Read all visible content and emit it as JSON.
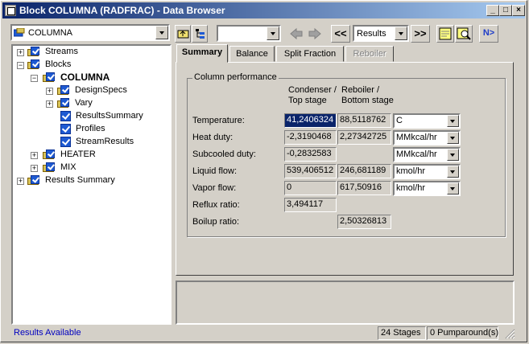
{
  "window": {
    "title": "Block COLUMNA (RADFRAC) - Data Browser",
    "buttons": {
      "minimize": "_",
      "maximize": "□",
      "close": "×"
    }
  },
  "toolbar": {
    "block_select": "COLUMNA",
    "empty_select": "",
    "prev_label": "<<",
    "results_select": "Results",
    "next_label": ">>",
    "nx_label": "N>"
  },
  "tree": {
    "items": [
      {
        "label": "Streams"
      },
      {
        "label": "Blocks"
      },
      {
        "label": "COLUMNA"
      },
      {
        "label": "DesignSpecs"
      },
      {
        "label": "Vary"
      },
      {
        "label": "ResultsSummary"
      },
      {
        "label": "Profiles"
      },
      {
        "label": "StreamResults"
      },
      {
        "label": "HEATER"
      },
      {
        "label": "MIX"
      },
      {
        "label": "Results Summary"
      }
    ]
  },
  "tabs": [
    {
      "label": "Summary",
      "active": true
    },
    {
      "label": "Balance"
    },
    {
      "label": "Split Fraction"
    },
    {
      "label": "Reboiler",
      "disabled": true
    }
  ],
  "summary": {
    "group_title": "Column performance",
    "col_headers": {
      "condenser_line1": "Condenser /",
      "condenser_line2": "Top stage",
      "reboiler_line1": "Reboiler /",
      "reboiler_line2": "Bottom stage"
    },
    "rows": [
      {
        "label": "Temperature:",
        "condenser": "41,2406324",
        "reboiler": "88,5118762",
        "unit": "C"
      },
      {
        "label": "Heat duty:",
        "condenser": "-2,3190468",
        "reboiler": "2,27342725",
        "unit": "MMkcal/hr"
      },
      {
        "label": "Subcooled duty:",
        "condenser": "-0,2832583",
        "reboiler": "",
        "unit": "MMkcal/hr"
      },
      {
        "label": "Liquid flow:",
        "condenser": "539,406512",
        "reboiler": "246,681189",
        "unit": "kmol/hr"
      },
      {
        "label": "Vapor flow:",
        "condenser": "0",
        "reboiler": "617,50916",
        "unit": "kmol/hr"
      },
      {
        "label": "Reflux ratio:",
        "condenser": "3,494117"
      },
      {
        "label": "Boilup ratio:",
        "reboiler": "2,50326813"
      }
    ]
  },
  "status": {
    "left": "Results Available",
    "stages": "24 Stages",
    "pumparounds": "0 Pumparound(s)"
  },
  "colors": {
    "title_start": "#0a246a",
    "title_end": "#a6caf0",
    "status_text": "#0000c0",
    "selection": "#0a246a"
  }
}
